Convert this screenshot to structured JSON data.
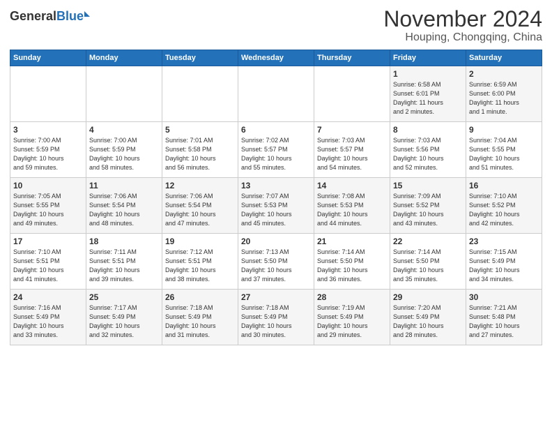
{
  "logo": {
    "general": "General",
    "blue": "Blue"
  },
  "title": "November 2024",
  "subtitle": "Houping, Chongqing, China",
  "days_of_week": [
    "Sunday",
    "Monday",
    "Tuesday",
    "Wednesday",
    "Thursday",
    "Friday",
    "Saturday"
  ],
  "weeks": [
    [
      {
        "day": "",
        "info": ""
      },
      {
        "day": "",
        "info": ""
      },
      {
        "day": "",
        "info": ""
      },
      {
        "day": "",
        "info": ""
      },
      {
        "day": "",
        "info": ""
      },
      {
        "day": "1",
        "info": "Sunrise: 6:58 AM\nSunset: 6:01 PM\nDaylight: 11 hours\nand 2 minutes."
      },
      {
        "day": "2",
        "info": "Sunrise: 6:59 AM\nSunset: 6:00 PM\nDaylight: 11 hours\nand 1 minute."
      }
    ],
    [
      {
        "day": "3",
        "info": "Sunrise: 7:00 AM\nSunset: 5:59 PM\nDaylight: 10 hours\nand 59 minutes."
      },
      {
        "day": "4",
        "info": "Sunrise: 7:00 AM\nSunset: 5:59 PM\nDaylight: 10 hours\nand 58 minutes."
      },
      {
        "day": "5",
        "info": "Sunrise: 7:01 AM\nSunset: 5:58 PM\nDaylight: 10 hours\nand 56 minutes."
      },
      {
        "day": "6",
        "info": "Sunrise: 7:02 AM\nSunset: 5:57 PM\nDaylight: 10 hours\nand 55 minutes."
      },
      {
        "day": "7",
        "info": "Sunrise: 7:03 AM\nSunset: 5:57 PM\nDaylight: 10 hours\nand 54 minutes."
      },
      {
        "day": "8",
        "info": "Sunrise: 7:03 AM\nSunset: 5:56 PM\nDaylight: 10 hours\nand 52 minutes."
      },
      {
        "day": "9",
        "info": "Sunrise: 7:04 AM\nSunset: 5:55 PM\nDaylight: 10 hours\nand 51 minutes."
      }
    ],
    [
      {
        "day": "10",
        "info": "Sunrise: 7:05 AM\nSunset: 5:55 PM\nDaylight: 10 hours\nand 49 minutes."
      },
      {
        "day": "11",
        "info": "Sunrise: 7:06 AM\nSunset: 5:54 PM\nDaylight: 10 hours\nand 48 minutes."
      },
      {
        "day": "12",
        "info": "Sunrise: 7:06 AM\nSunset: 5:54 PM\nDaylight: 10 hours\nand 47 minutes."
      },
      {
        "day": "13",
        "info": "Sunrise: 7:07 AM\nSunset: 5:53 PM\nDaylight: 10 hours\nand 45 minutes."
      },
      {
        "day": "14",
        "info": "Sunrise: 7:08 AM\nSunset: 5:53 PM\nDaylight: 10 hours\nand 44 minutes."
      },
      {
        "day": "15",
        "info": "Sunrise: 7:09 AM\nSunset: 5:52 PM\nDaylight: 10 hours\nand 43 minutes."
      },
      {
        "day": "16",
        "info": "Sunrise: 7:10 AM\nSunset: 5:52 PM\nDaylight: 10 hours\nand 42 minutes."
      }
    ],
    [
      {
        "day": "17",
        "info": "Sunrise: 7:10 AM\nSunset: 5:51 PM\nDaylight: 10 hours\nand 41 minutes."
      },
      {
        "day": "18",
        "info": "Sunrise: 7:11 AM\nSunset: 5:51 PM\nDaylight: 10 hours\nand 39 minutes."
      },
      {
        "day": "19",
        "info": "Sunrise: 7:12 AM\nSunset: 5:51 PM\nDaylight: 10 hours\nand 38 minutes."
      },
      {
        "day": "20",
        "info": "Sunrise: 7:13 AM\nSunset: 5:50 PM\nDaylight: 10 hours\nand 37 minutes."
      },
      {
        "day": "21",
        "info": "Sunrise: 7:14 AM\nSunset: 5:50 PM\nDaylight: 10 hours\nand 36 minutes."
      },
      {
        "day": "22",
        "info": "Sunrise: 7:14 AM\nSunset: 5:50 PM\nDaylight: 10 hours\nand 35 minutes."
      },
      {
        "day": "23",
        "info": "Sunrise: 7:15 AM\nSunset: 5:49 PM\nDaylight: 10 hours\nand 34 minutes."
      }
    ],
    [
      {
        "day": "24",
        "info": "Sunrise: 7:16 AM\nSunset: 5:49 PM\nDaylight: 10 hours\nand 33 minutes."
      },
      {
        "day": "25",
        "info": "Sunrise: 7:17 AM\nSunset: 5:49 PM\nDaylight: 10 hours\nand 32 minutes."
      },
      {
        "day": "26",
        "info": "Sunrise: 7:18 AM\nSunset: 5:49 PM\nDaylight: 10 hours\nand 31 minutes."
      },
      {
        "day": "27",
        "info": "Sunrise: 7:18 AM\nSunset: 5:49 PM\nDaylight: 10 hours\nand 30 minutes."
      },
      {
        "day": "28",
        "info": "Sunrise: 7:19 AM\nSunset: 5:49 PM\nDaylight: 10 hours\nand 29 minutes."
      },
      {
        "day": "29",
        "info": "Sunrise: 7:20 AM\nSunset: 5:49 PM\nDaylight: 10 hours\nand 28 minutes."
      },
      {
        "day": "30",
        "info": "Sunrise: 7:21 AM\nSunset: 5:48 PM\nDaylight: 10 hours\nand 27 minutes."
      }
    ]
  ]
}
